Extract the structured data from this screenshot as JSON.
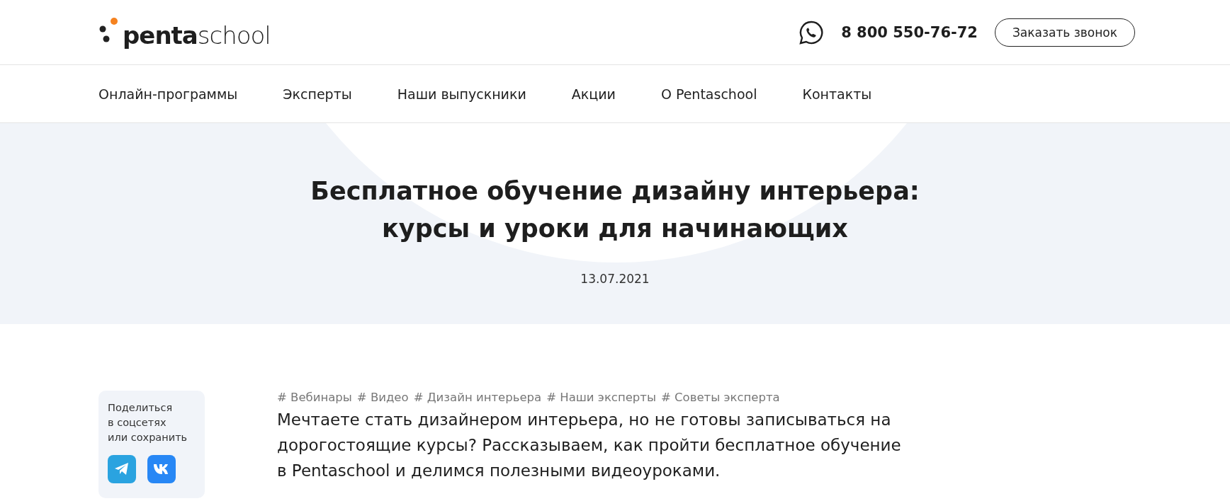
{
  "header": {
    "logo": "**penta**school",
    "phone": "8 800 550-76-72",
    "callback_button": "Заказать звонок"
  },
  "nav": [
    "Онлайн-программы",
    "Эксперты",
    "Наши выпускники",
    "Акции",
    "О Pentaschool",
    "Контакты"
  ],
  "hero": {
    "title_lines": [
      "Бесплатное обучение дизайну интерьера:",
      "курсы и уроки для начинающих"
    ],
    "date": "13.07.2021"
  },
  "share": {
    "label_lines": [
      "Поделиться",
      "в соцсетях",
      "или сохранить"
    ]
  },
  "article": {
    "tags": [
      "# Вебинары",
      "# Видео",
      "# Дизайн интерьера",
      "# Наши эксперты",
      "# Советы эксперта"
    ],
    "lead": "Мечтаете стать дизайнером интерьера, но не готовы записываться на дорогостоящие курсы? Рассказываем, как пройти бесплатное обучение в Pentaschool и делимся полезными видеоуроками."
  }
}
